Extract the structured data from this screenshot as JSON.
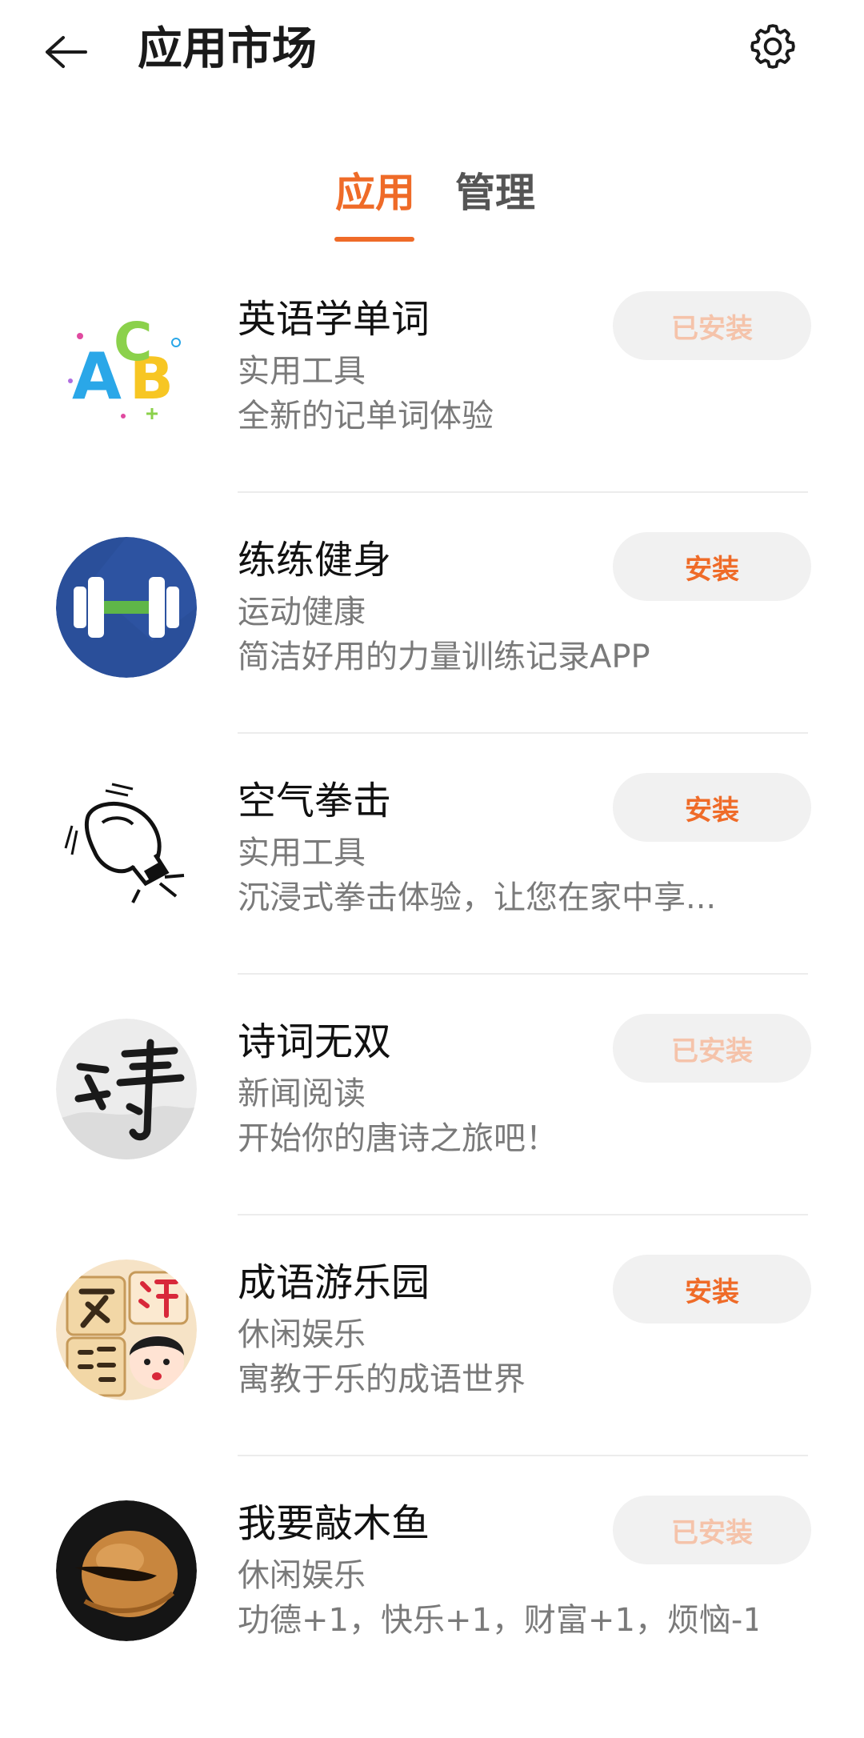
{
  "header": {
    "title": "应用市场",
    "back_icon": "arrow-left-icon",
    "settings_icon": "gear-icon"
  },
  "tabs": [
    {
      "label": "应用",
      "active": true
    },
    {
      "label": "管理",
      "active": false
    }
  ],
  "colors": {
    "accent": "#ef6b28",
    "installed_text": "#f5c3aa",
    "button_bg": "#f1f1f1"
  },
  "apps": [
    {
      "name": "英语学单词",
      "category": "实用工具",
      "description": "全新的记单词体验",
      "button": "已安装",
      "installed": true,
      "icon": "abc-letters-icon"
    },
    {
      "name": "练练健身",
      "category": "运动健康",
      "description": "简洁好用的力量训练记录APP",
      "button": "安装",
      "installed": false,
      "icon": "dumbbell-icon"
    },
    {
      "name": "空气拳击",
      "category": "实用工具",
      "description": "沉浸式拳击体验，让您在家中享...",
      "button": "安装",
      "installed": false,
      "icon": "boxing-glove-icon"
    },
    {
      "name": "诗词无双",
      "category": "新闻阅读",
      "description": "开始你的唐诗之旅吧！",
      "button": "已安装",
      "installed": true,
      "icon": "poem-calligraphy-icon"
    },
    {
      "name": "成语游乐园",
      "category": "休闲娱乐",
      "description": "寓教于乐的成语世界",
      "button": "安装",
      "installed": false,
      "icon": "idiom-game-icon"
    },
    {
      "name": "我要敲木鱼",
      "category": "休闲娱乐",
      "description": "功德+1，快乐+1，财富+1，烦恼-1",
      "button": "已安装",
      "installed": true,
      "icon": "wooden-fish-icon"
    }
  ]
}
